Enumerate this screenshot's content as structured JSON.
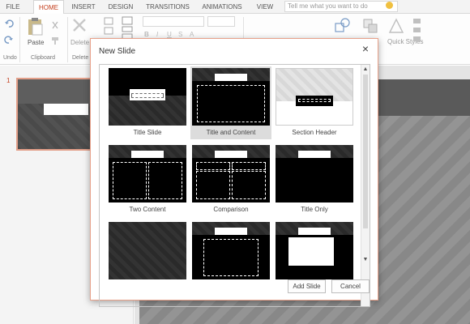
{
  "ribbon": {
    "tabs": [
      {
        "label": "FILE",
        "active": false
      },
      {
        "label": "HOME",
        "active": true
      },
      {
        "label": "INSERT",
        "active": false
      },
      {
        "label": "DESIGN",
        "active": false
      },
      {
        "label": "TRANSITIONS",
        "active": false
      },
      {
        "label": "ANIMATIONS",
        "active": false
      },
      {
        "label": "VIEW",
        "active": false
      }
    ],
    "tell_me_placeholder": "Tell me what you want to do",
    "paste_label": "Paste",
    "delete_label": "Delete",
    "quick_styles_label": "Quick Styles",
    "group_undo": "Undo",
    "group_clipboard": "Clipboard",
    "group_delete": "Delete",
    "group_drawing_fragment": "wing",
    "accent_color": "#c43e1c"
  },
  "thumbnails": {
    "slide_number": "1"
  },
  "dialog": {
    "title": "New Slide",
    "close_glyph": "×",
    "layouts": [
      {
        "name": "Title Slide",
        "selected": false
      },
      {
        "name": "Title and Content",
        "selected": true
      },
      {
        "name": "Section Header",
        "selected": false
      },
      {
        "name": "Two Content",
        "selected": false
      },
      {
        "name": "Comparison",
        "selected": false
      },
      {
        "name": "Title Only",
        "selected": false
      }
    ],
    "add_button": "Add Slide",
    "cancel_button": "Cancel",
    "scroll_up_glyph": "▲",
    "scroll_down_glyph": "▼"
  }
}
